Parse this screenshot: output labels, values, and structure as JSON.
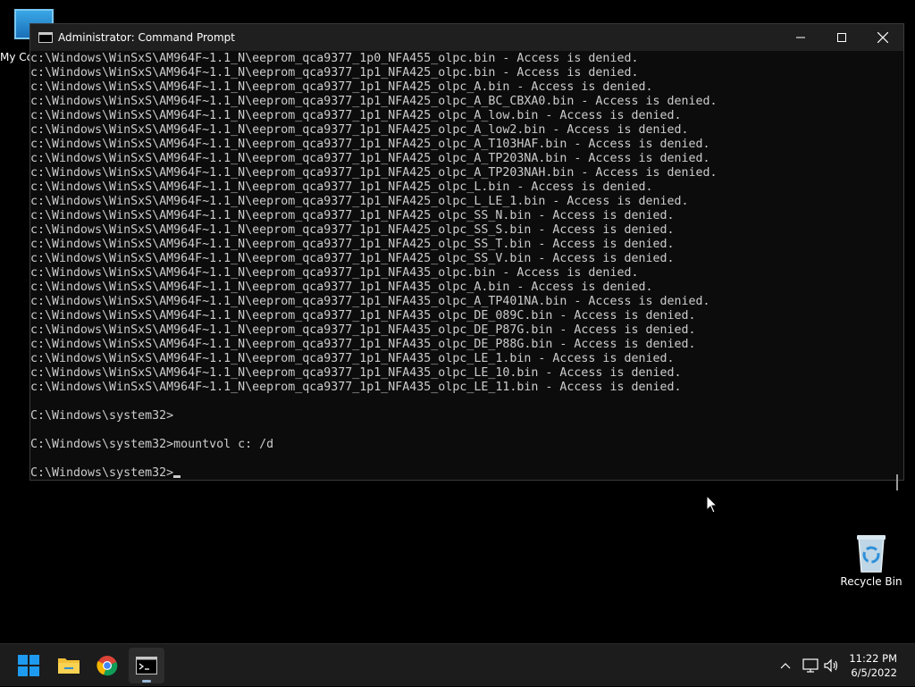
{
  "desktop": {
    "icons": [
      {
        "label": "My Cc"
      },
      {
        "label": "Recycle Bin"
      }
    ]
  },
  "window": {
    "title": "Administrator: Command Prompt",
    "controls": {
      "minimize": "—",
      "maximize": "☐",
      "close": "✕"
    }
  },
  "console": {
    "lines": [
      "c:\\Windows\\WinSxS\\AM964F~1.1_N\\eeprom_qca9377_1p0_NFA455_olpc.bin - Access is denied.",
      "c:\\Windows\\WinSxS\\AM964F~1.1_N\\eeprom_qca9377_1p1_NFA425_olpc.bin - Access is denied.",
      "c:\\Windows\\WinSxS\\AM964F~1.1_N\\eeprom_qca9377_1p1_NFA425_olpc_A.bin - Access is denied.",
      "c:\\Windows\\WinSxS\\AM964F~1.1_N\\eeprom_qca9377_1p1_NFA425_olpc_A_BC_CBXA0.bin - Access is denied.",
      "c:\\Windows\\WinSxS\\AM964F~1.1_N\\eeprom_qca9377_1p1_NFA425_olpc_A_low.bin - Access is denied.",
      "c:\\Windows\\WinSxS\\AM964F~1.1_N\\eeprom_qca9377_1p1_NFA425_olpc_A_low2.bin - Access is denied.",
      "c:\\Windows\\WinSxS\\AM964F~1.1_N\\eeprom_qca9377_1p1_NFA425_olpc_A_T103HAF.bin - Access is denied.",
      "c:\\Windows\\WinSxS\\AM964F~1.1_N\\eeprom_qca9377_1p1_NFA425_olpc_A_TP203NA.bin - Access is denied.",
      "c:\\Windows\\WinSxS\\AM964F~1.1_N\\eeprom_qca9377_1p1_NFA425_olpc_A_TP203NAH.bin - Access is denied.",
      "c:\\Windows\\WinSxS\\AM964F~1.1_N\\eeprom_qca9377_1p1_NFA425_olpc_L.bin - Access is denied.",
      "c:\\Windows\\WinSxS\\AM964F~1.1_N\\eeprom_qca9377_1p1_NFA425_olpc_L_LE_1.bin - Access is denied.",
      "c:\\Windows\\WinSxS\\AM964F~1.1_N\\eeprom_qca9377_1p1_NFA425_olpc_SS_N.bin - Access is denied.",
      "c:\\Windows\\WinSxS\\AM964F~1.1_N\\eeprom_qca9377_1p1_NFA425_olpc_SS_S.bin - Access is denied.",
      "c:\\Windows\\WinSxS\\AM964F~1.1_N\\eeprom_qca9377_1p1_NFA425_olpc_SS_T.bin - Access is denied.",
      "c:\\Windows\\WinSxS\\AM964F~1.1_N\\eeprom_qca9377_1p1_NFA425_olpc_SS_V.bin - Access is denied.",
      "c:\\Windows\\WinSxS\\AM964F~1.1_N\\eeprom_qca9377_1p1_NFA435_olpc.bin - Access is denied.",
      "c:\\Windows\\WinSxS\\AM964F~1.1_N\\eeprom_qca9377_1p1_NFA435_olpc_A.bin - Access is denied.",
      "c:\\Windows\\WinSxS\\AM964F~1.1_N\\eeprom_qca9377_1p1_NFA435_olpc_A_TP401NA.bin - Access is denied.",
      "c:\\Windows\\WinSxS\\AM964F~1.1_N\\eeprom_qca9377_1p1_NFA435_olpc_DE_089C.bin - Access is denied.",
      "c:\\Windows\\WinSxS\\AM964F~1.1_N\\eeprom_qca9377_1p1_NFA435_olpc_DE_P87G.bin - Access is denied.",
      "c:\\Windows\\WinSxS\\AM964F~1.1_N\\eeprom_qca9377_1p1_NFA435_olpc_DE_P88G.bin - Access is denied.",
      "c:\\Windows\\WinSxS\\AM964F~1.1_N\\eeprom_qca9377_1p1_NFA435_olpc_LE_1.bin - Access is denied.",
      "c:\\Windows\\WinSxS\\AM964F~1.1_N\\eeprom_qca9377_1p1_NFA435_olpc_LE_10.bin - Access is denied.",
      "c:\\Windows\\WinSxS\\AM964F~1.1_N\\eeprom_qca9377_1p1_NFA435_olpc_LE_11.bin - Access is denied.",
      "",
      "C:\\Windows\\system32>",
      "",
      "C:\\Windows\\system32>mountvol c: /d",
      ""
    ],
    "prompt": "C:\\Windows\\system32>"
  },
  "taskbar": {
    "apps": [
      {
        "name": "start-button",
        "icon": "windows-logo-icon"
      },
      {
        "name": "file-explorer",
        "icon": "folder-icon"
      },
      {
        "name": "chrome",
        "icon": "chrome-icon"
      },
      {
        "name": "command-prompt",
        "icon": "terminal-icon",
        "active": true
      }
    ],
    "tray": {
      "time": "11:22 PM",
      "date": "6/5/2022"
    }
  },
  "colors": {
    "console_bg": "#0c0c0c",
    "console_text": "#cccccc",
    "taskbar_bg": "#1c1c1c",
    "titlebar_bg": "#1f1f1f",
    "windows_blue": "#1e9bf0"
  }
}
